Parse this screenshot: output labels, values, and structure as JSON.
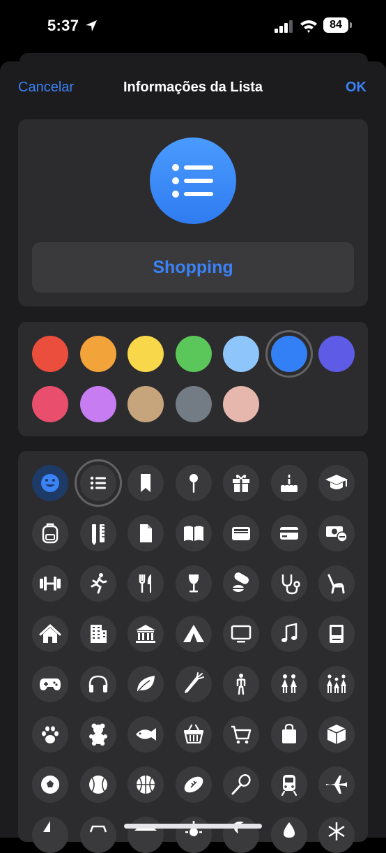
{
  "status_bar": {
    "time": "5:37",
    "battery": "84"
  },
  "nav": {
    "cancel": "Cancelar",
    "title": "Informações da Lista",
    "ok": "OK"
  },
  "list": {
    "name": "Shopping",
    "icon": "list-bullet-icon",
    "accent_color": "#3b82f6"
  },
  "colors": {
    "selected": "blue",
    "options": [
      {
        "name": "red",
        "hex": "#eb4e3d"
      },
      {
        "name": "orange",
        "hex": "#f2a33a"
      },
      {
        "name": "yellow",
        "hex": "#f8d74a"
      },
      {
        "name": "green",
        "hex": "#5bc75a"
      },
      {
        "name": "light-blue",
        "hex": "#8ec5fb"
      },
      {
        "name": "blue",
        "hex": "#3380f6"
      },
      {
        "name": "indigo",
        "hex": "#5e5ce6"
      },
      {
        "name": "pink",
        "hex": "#ea4e6d"
      },
      {
        "name": "purple",
        "hex": "#c77cf2"
      },
      {
        "name": "tan",
        "hex": "#c7a57c"
      },
      {
        "name": "gray",
        "hex": "#737b85"
      },
      {
        "name": "rose",
        "hex": "#e5b7ad"
      }
    ]
  },
  "icons": {
    "selected": "list-bullet-icon",
    "items": [
      "smiley-icon",
      "list-bullet-icon",
      "bookmark-icon",
      "pin-icon",
      "gift-icon",
      "birthday-cake-icon",
      "graduation-cap-icon",
      "backpack-icon",
      "ruler-pencil-icon",
      "document-icon",
      "book-icon",
      "wallet-icon",
      "credit-card-icon",
      "money-icon",
      "dumbbell-icon",
      "running-icon",
      "fork-knife-icon",
      "wine-glass-icon",
      "pills-icon",
      "stethoscope-icon",
      "chair-icon",
      "house-icon",
      "building-icon",
      "bank-icon",
      "tent-icon",
      "tv-icon",
      "music-note-icon",
      "computer-icon",
      "gamecontroller-icon",
      "headphones-icon",
      "leaf-icon",
      "carrot-icon",
      "person-icon",
      "two-people-icon",
      "family-icon",
      "pawprint-icon",
      "teddy-bear-icon",
      "fish-icon",
      "basket-icon",
      "cart-icon",
      "shopping-bag-icon",
      "box-icon",
      "soccer-ball-icon",
      "baseball-icon",
      "basketball-icon",
      "football-icon",
      "tennis-racket-icon",
      "train-icon",
      "airplane-icon",
      "sailboat-icon",
      "car-icon",
      "umbrella-icon",
      "sun-icon",
      "moon-icon",
      "drop-icon",
      "snowflake-icon"
    ]
  }
}
